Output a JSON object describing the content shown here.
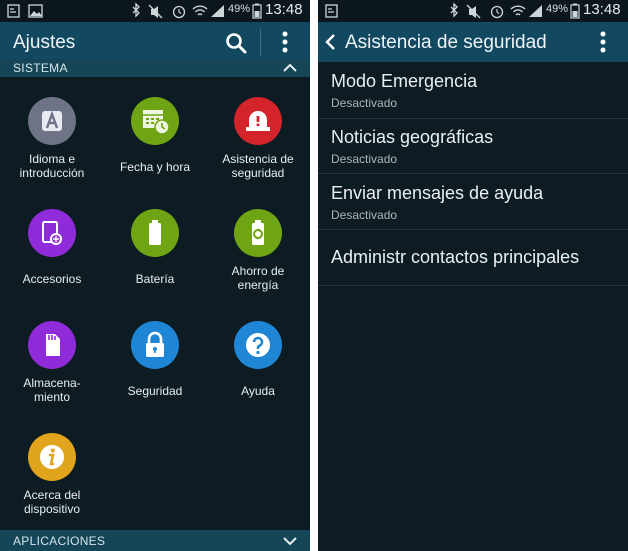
{
  "status": {
    "battery": "49%",
    "time": "13:48"
  },
  "left": {
    "title": "Ajustes",
    "section": "SISTEMA",
    "bottom_section": "APLICACIONES",
    "tiles": [
      {
        "label": "Idioma e\nintroducción",
        "color": "#6e7385",
        "icon": "language-icon"
      },
      {
        "label": "Fecha y hora",
        "color": "#6fa514",
        "icon": "calendar-clock-icon"
      },
      {
        "label": "Asistencia de\nseguridad",
        "color": "#d3232b",
        "icon": "warning-siren-icon"
      },
      {
        "label": "Accesorios",
        "color": "#8f2bd9",
        "icon": "accessory-icon"
      },
      {
        "label": "Batería",
        "color": "#6fa514",
        "icon": "battery-icon"
      },
      {
        "label": "Ahorro de\nenergía",
        "color": "#6fa514",
        "icon": "power-saving-icon"
      },
      {
        "label": "Almacena-\nmiento",
        "color": "#8f2bd9",
        "icon": "sd-card-icon"
      },
      {
        "label": "Seguridad",
        "color": "#1f86d6",
        "icon": "lock-icon"
      },
      {
        "label": "Ayuda",
        "color": "#1f86d6",
        "icon": "help-icon"
      },
      {
        "label": "Acerca del\ndispositivo",
        "color": "#e0a51c",
        "icon": "info-icon"
      }
    ]
  },
  "right": {
    "title": "Asistencia de seguridad",
    "items": [
      {
        "title": "Modo Emergencia",
        "subtitle": "Desactivado"
      },
      {
        "title": "Noticias geográficas",
        "subtitle": "Desactivado"
      },
      {
        "title": "Enviar mensajes de ayuda",
        "subtitle": "Desactivado"
      },
      {
        "title": "Administr contactos principales"
      }
    ]
  }
}
